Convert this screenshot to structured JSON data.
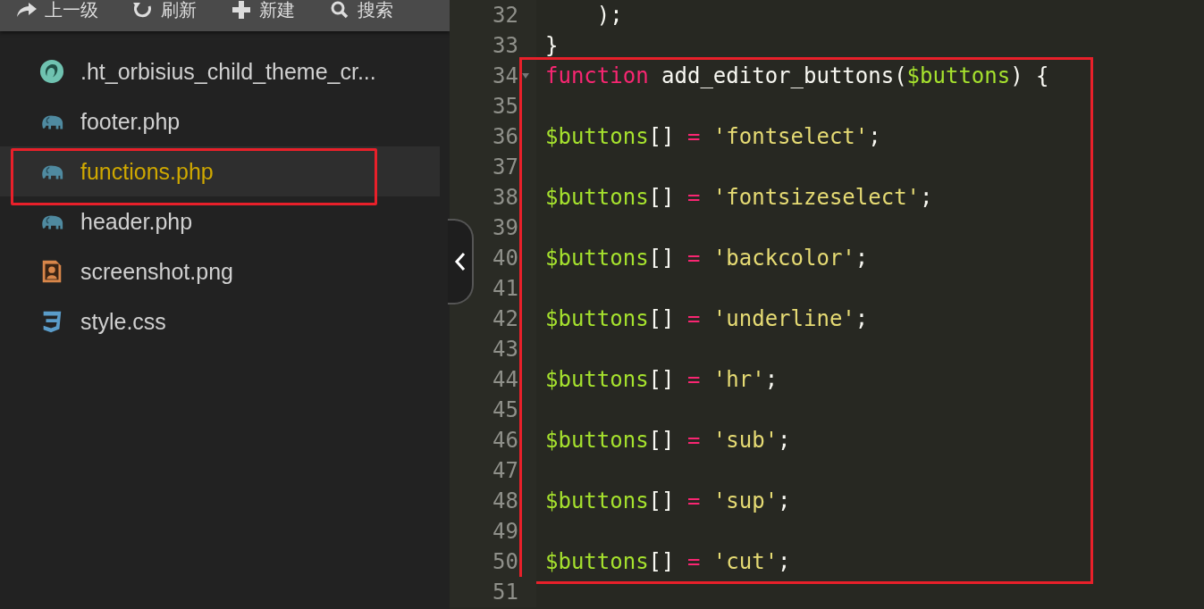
{
  "toolbar": [
    {
      "kind": "up",
      "label": "上一级"
    },
    {
      "kind": "refresh",
      "label": "刷新"
    },
    {
      "kind": "new",
      "label": "新建"
    },
    {
      "kind": "search",
      "label": "搜索"
    }
  ],
  "files": [
    {
      "name": ".ht_orbisius_child_theme_cr...",
      "kind": "config",
      "selected": false,
      "marked": false
    },
    {
      "name": "footer.php",
      "kind": "php",
      "selected": false,
      "marked": false
    },
    {
      "name": "functions.php",
      "kind": "php",
      "selected": true,
      "marked": true
    },
    {
      "name": "header.php",
      "kind": "php",
      "selected": false,
      "marked": false
    },
    {
      "name": "screenshot.png",
      "kind": "image",
      "selected": false,
      "marked": false
    },
    {
      "name": "style.css",
      "kind": "css",
      "selected": false,
      "marked": false
    }
  ],
  "editor": {
    "lines": [
      {
        "number": "32",
        "foldable": false,
        "marked": false,
        "tokens": [
          {
            "kind": "plain",
            "text": "    );"
          }
        ]
      },
      {
        "number": "33",
        "foldable": false,
        "marked": false,
        "tokens": [
          {
            "kind": "plain",
            "text": "}"
          }
        ]
      },
      {
        "number": "34",
        "foldable": true,
        "marked": true,
        "tokens": [
          {
            "kind": "keyword",
            "text": "function"
          },
          {
            "kind": "plain",
            "text": " add_editor_buttons("
          },
          {
            "kind": "variable",
            "text": "$buttons"
          },
          {
            "kind": "plain",
            "text": ") {"
          }
        ]
      },
      {
        "number": "35",
        "foldable": false,
        "marked": true
      },
      {
        "number": "36",
        "foldable": false,
        "marked": true,
        "tokens": [
          {
            "kind": "variable",
            "text": "$buttons"
          },
          {
            "kind": "plain",
            "text": "[] "
          },
          {
            "kind": "keyword",
            "text": "= "
          },
          {
            "kind": "string",
            "text": "'fontselect'"
          },
          {
            "kind": "plain",
            "text": ";"
          }
        ]
      },
      {
        "number": "37",
        "foldable": false,
        "marked": true
      },
      {
        "number": "38",
        "foldable": false,
        "marked": true,
        "tokens": [
          {
            "kind": "variable",
            "text": "$buttons"
          },
          {
            "kind": "plain",
            "text": "[] "
          },
          {
            "kind": "keyword",
            "text": "= "
          },
          {
            "kind": "string",
            "text": "'fontsizeselect'"
          },
          {
            "kind": "plain",
            "text": ";"
          }
        ]
      },
      {
        "number": "39",
        "foldable": false,
        "marked": true
      },
      {
        "number": "40",
        "foldable": false,
        "marked": true,
        "tokens": [
          {
            "kind": "variable",
            "text": "$buttons"
          },
          {
            "kind": "plain",
            "text": "[] "
          },
          {
            "kind": "keyword",
            "text": "= "
          },
          {
            "kind": "string",
            "text": "'backcolor'"
          },
          {
            "kind": "plain",
            "text": ";"
          }
        ]
      },
      {
        "number": "41",
        "foldable": false,
        "marked": true
      },
      {
        "number": "42",
        "foldable": false,
        "marked": true,
        "tokens": [
          {
            "kind": "variable",
            "text": "$buttons"
          },
          {
            "kind": "plain",
            "text": "[] "
          },
          {
            "kind": "keyword",
            "text": "= "
          },
          {
            "kind": "string",
            "text": "'underline'"
          },
          {
            "kind": "plain",
            "text": ";"
          }
        ]
      },
      {
        "number": "43",
        "foldable": false,
        "marked": true
      },
      {
        "number": "44",
        "foldable": false,
        "marked": true,
        "tokens": [
          {
            "kind": "variable",
            "text": "$buttons"
          },
          {
            "kind": "plain",
            "text": "[] "
          },
          {
            "kind": "keyword",
            "text": "= "
          },
          {
            "kind": "string",
            "text": "'hr'"
          },
          {
            "kind": "plain",
            "text": ";"
          }
        ]
      },
      {
        "number": "45",
        "foldable": false,
        "marked": true
      },
      {
        "number": "46",
        "foldable": false,
        "marked": true,
        "tokens": [
          {
            "kind": "variable",
            "text": "$buttons"
          },
          {
            "kind": "plain",
            "text": "[] "
          },
          {
            "kind": "keyword",
            "text": "= "
          },
          {
            "kind": "string",
            "text": "'sub'"
          },
          {
            "kind": "plain",
            "text": ";"
          }
        ]
      },
      {
        "number": "47",
        "foldable": false,
        "marked": true
      },
      {
        "number": "48",
        "foldable": false,
        "marked": true,
        "tokens": [
          {
            "kind": "variable",
            "text": "$buttons"
          },
          {
            "kind": "plain",
            "text": "[] "
          },
          {
            "kind": "keyword",
            "text": "= "
          },
          {
            "kind": "string",
            "text": "'sup'"
          },
          {
            "kind": "plain",
            "text": ";"
          }
        ]
      },
      {
        "number": "49",
        "foldable": false,
        "marked": true
      },
      {
        "number": "50",
        "foldable": false,
        "marked": true,
        "tokens": [
          {
            "kind": "variable",
            "text": "$buttons"
          },
          {
            "kind": "plain",
            "text": "[] "
          },
          {
            "kind": "keyword",
            "text": "= "
          },
          {
            "kind": "string",
            "text": "'cut'"
          },
          {
            "kind": "plain",
            "text": ";"
          }
        ]
      },
      {
        "number": "51",
        "foldable": false,
        "marked": false
      }
    ]
  }
}
